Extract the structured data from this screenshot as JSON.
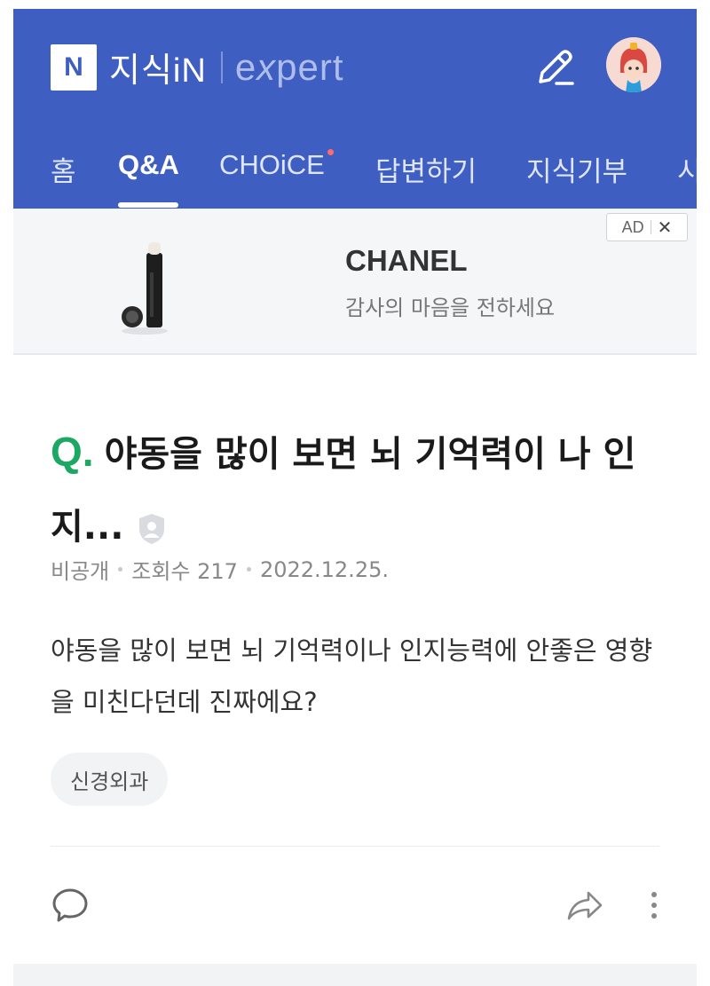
{
  "header": {
    "logo_letter": "N",
    "service_name": "지식iN",
    "expert_label": "expert",
    "brand_color": "#3e5ec1",
    "tabs": [
      {
        "label": "홈",
        "active": false
      },
      {
        "label": "Q&A",
        "active": true
      },
      {
        "label": "CHOiCE",
        "active": false,
        "new_dot": true
      },
      {
        "label": "답변하기",
        "active": false
      },
      {
        "label": "지식기부",
        "active": false
      },
      {
        "label": "시",
        "active": false
      }
    ],
    "icons": {
      "write": "pencil-icon",
      "profile": "avatar"
    }
  },
  "ad": {
    "brand": "CHANEL",
    "copy": "감사의 마음을 전하세요",
    "badge_label": "AD",
    "close_label": "✕"
  },
  "question": {
    "q_mark": "Q.",
    "title": "야동을 많이 보면 뇌 기억력이 나 인지...",
    "author": "비공개",
    "views": "조회수 217",
    "date": "2022.12.25.",
    "body": "야동을 많이 보면 뇌 기억력이나 인지능력에 안좋은 영향을 미친다던데 진짜에요?",
    "tag": "신경외과",
    "q_color": "#1ba862"
  },
  "actions": {
    "comment": "comment-icon",
    "share": "share-icon",
    "more": "more-icon"
  }
}
